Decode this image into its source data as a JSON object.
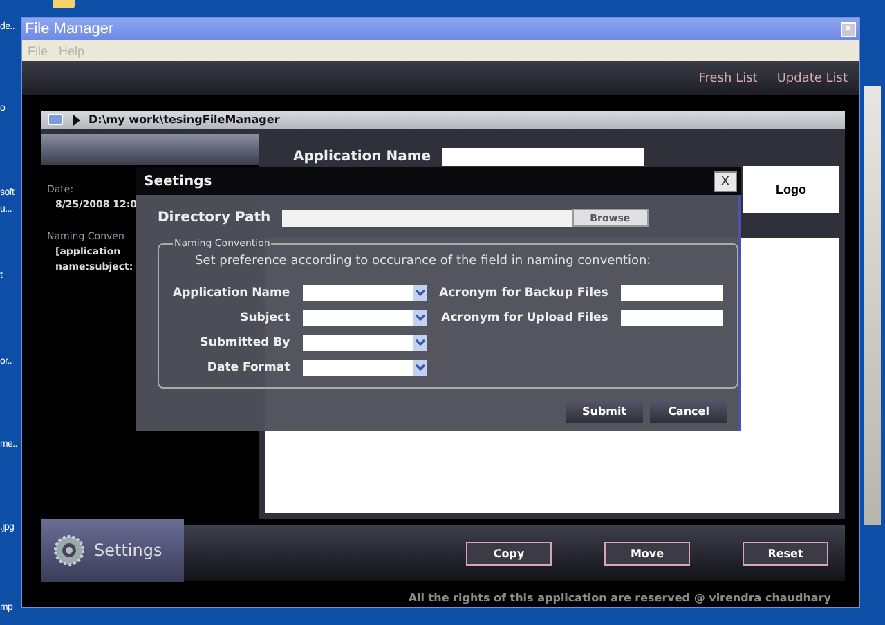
{
  "desktop": {
    "icon_labels": [
      "de..",
      "o",
      "soft",
      "u...",
      "t",
      "or..",
      "me..",
      ".jpg",
      "mp"
    ]
  },
  "window": {
    "title": "File Manager",
    "close": "×"
  },
  "menu": [
    "File",
    "Help"
  ],
  "toolbar": {
    "links": [
      "Fresh List",
      "Update List"
    ]
  },
  "path_bar": {
    "path": "D:\\my work\\tesingFileManager"
  },
  "left_panel": {
    "date_label": "Date:",
    "date_value": "8/25/2008 12:0",
    "naming_label": "Naming Conven",
    "naming_value": [
      "[application",
      "name:subject:"
    ]
  },
  "form": {
    "application_name_label": "Application Name"
  },
  "logo": "Logo",
  "settings_tab": {
    "label": "Settings",
    "selected": true
  },
  "buttons": [
    "Copy",
    "Move",
    "Reset"
  ],
  "footer": "All the rights of this application are reserved @ virendra chaudhary",
  "dialog": {
    "title": "Seetings",
    "close": "X",
    "directory_label": "Directory Path",
    "browse": "Browse",
    "group_title": "Naming Convention",
    "instruction": "Set preference according to occurance of the field in naming convention:",
    "selects": [
      {
        "label": "Application Name"
      },
      {
        "label": "Subject"
      },
      {
        "label": "Submitted By"
      },
      {
        "label": "Date Format"
      }
    ],
    "acronyms": [
      {
        "label": "Acronym for Backup Files"
      },
      {
        "label": "Acronym for Upload Files"
      }
    ],
    "buttons": [
      "Submit",
      "Cancel"
    ]
  }
}
